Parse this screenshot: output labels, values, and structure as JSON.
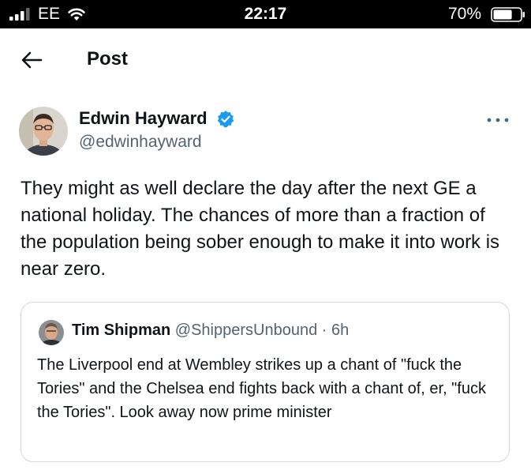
{
  "status_bar": {
    "carrier": "EE",
    "time": "22:17",
    "battery_percent": "70%",
    "battery_level": 0.7,
    "icons": [
      "signal-icon",
      "wifi-icon",
      "battery-icon"
    ]
  },
  "header": {
    "title": "Post",
    "back_icon": "arrow-left-icon"
  },
  "post": {
    "author": {
      "name": "Edwin Hayward",
      "handle": "@edwinhayward",
      "verified": true,
      "avatar_icon": "avatar"
    },
    "more_icon": "more-dots-icon",
    "text": "They might as well declare the day after the next GE a national holiday. The chances of more than a fraction of the population being sober enough to make it into work is near zero.",
    "quote": {
      "author_name": "Tim Shipman",
      "author_handle": "@ShippersUnbound",
      "separator": "·",
      "time": "6h",
      "text": "The Liverpool end at Wembley strikes up a chant of \"fuck the Tories\" and the Chelsea end fights back with a chant of, er, \"fuck the Tories\". Look away now prime minister"
    }
  },
  "colors": {
    "verified_blue": "#1d9bf0",
    "secondary_text": "#536471",
    "border": "#cfd9de",
    "text": "#0f1419"
  }
}
